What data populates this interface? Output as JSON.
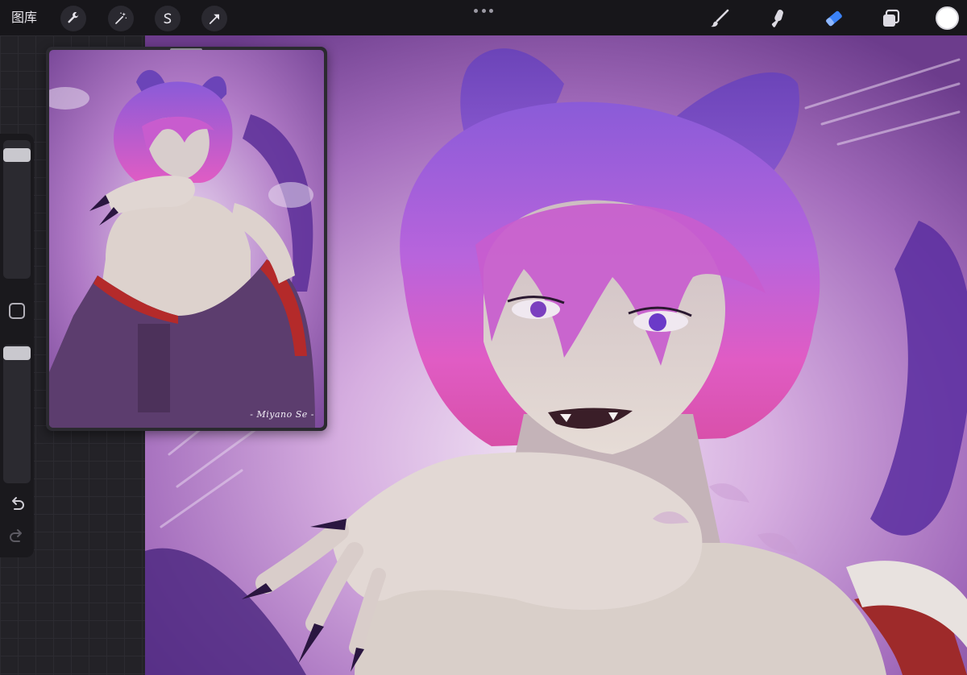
{
  "toolbar": {
    "gallery_label": "图库",
    "left_tools": [
      "wrench-icon",
      "magic-wand-icon",
      "selection-icon",
      "transform-arrow-icon"
    ],
    "right_tools": [
      "brush-icon",
      "smudge-icon",
      "eraser-icon",
      "layers-icon"
    ],
    "active_tool": "eraser",
    "accent_color": "#3b82f6",
    "current_color": "#ffffff"
  },
  "sidebar": {
    "brush_size": 0.95,
    "opacity": 1.0
  },
  "reference": {
    "signature": "- Miyano Se -"
  },
  "colors": {
    "bg_dark": "#17161a",
    "canvas_purple": "#9a5fb8",
    "hair_pink": "#d85fc8",
    "hair_violet": "#8f5ad8",
    "skin": "#d9d2cc"
  }
}
